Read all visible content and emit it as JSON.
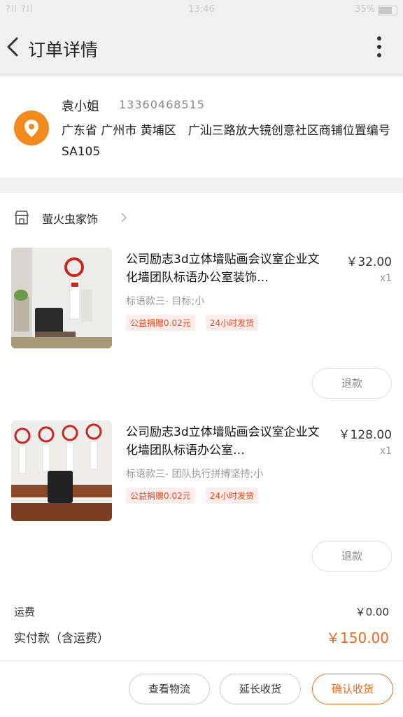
{
  "status_bar": {
    "signal": "?ll ?ll",
    "time": "13:46",
    "battery": "35%"
  },
  "header": {
    "title": "订单详情"
  },
  "address": {
    "name": "袁小姐",
    "phone": "13360468515",
    "detail": "广东省 广州市 黄埔区　广汕三路放大镜创意社区商铺位置编号SA105"
  },
  "shop": {
    "name": "萤火虫家饰"
  },
  "items": [
    {
      "title": "公司励志3d立体墙贴画会议室企业文化墙团队标语办公室装饰…",
      "price": "￥32.00",
      "qty": "x1",
      "spec": "标语款三- 目标;小",
      "tags": [
        "公益捐赠0.02元",
        "24小时发货"
      ],
      "refund": "退款"
    },
    {
      "title": "公司励志3d立体墙贴画会议室企业文化墙团队标语办公室…",
      "price": "￥128.00",
      "qty": "x1",
      "spec": "标语款三- 团队执行拼搏坚持;小",
      "tags": [
        "公益捐赠0.02元",
        "24小时发货"
      ],
      "refund": "退款"
    }
  ],
  "totals": {
    "shipping_label": "运费",
    "shipping_value": "￥0.00",
    "paid_label": "实付款（含运费）",
    "paid_value": "￥150.00"
  },
  "actions": {
    "view_logistics": "查看物流",
    "extend_receipt": "延长收货",
    "confirm_receipt": "确认收货"
  },
  "colors": {
    "accent": "#e86a1e",
    "tag_text": "#e54b1c",
    "tag_bg": "#fdecec"
  }
}
